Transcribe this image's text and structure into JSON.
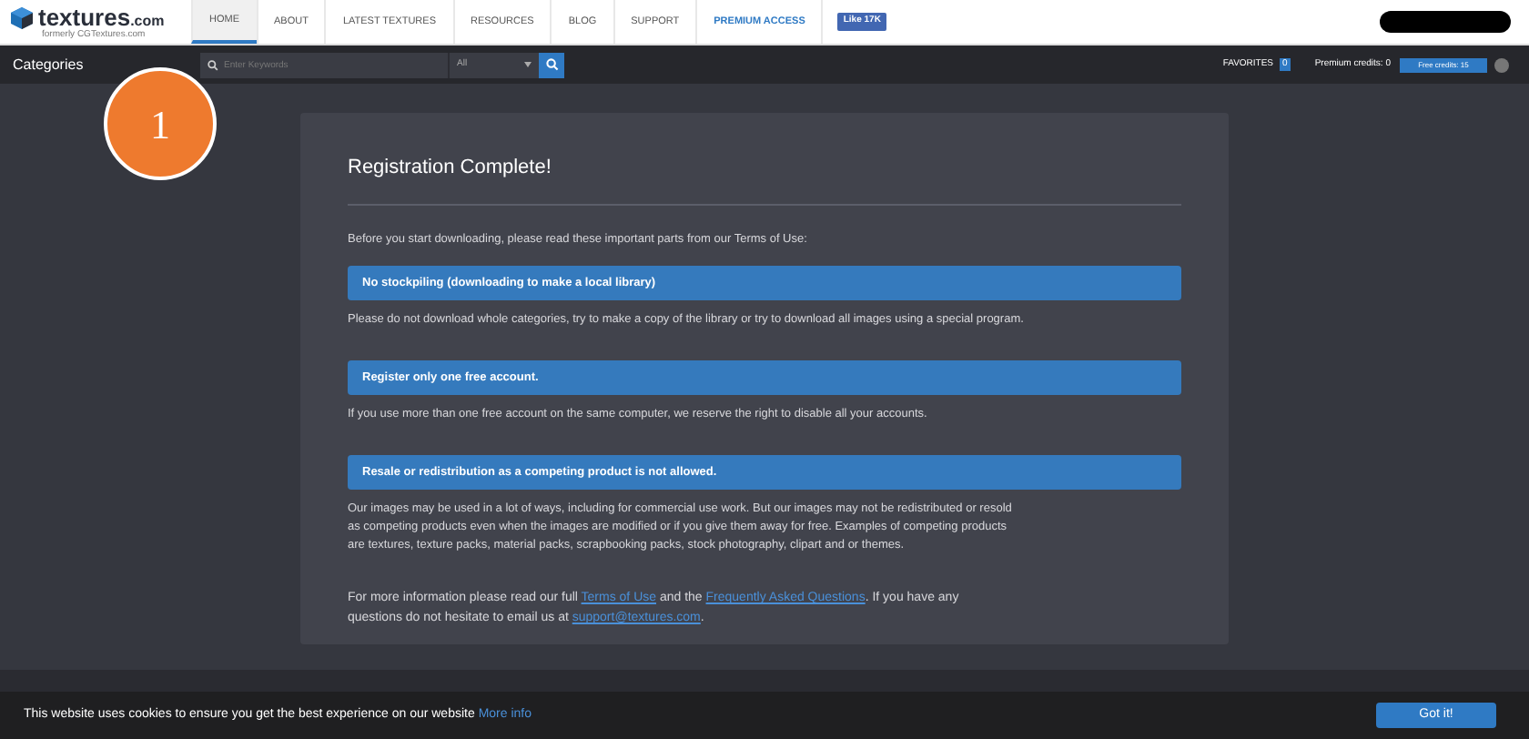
{
  "logo": {
    "name": "textures",
    "suffix": ".com",
    "tagline": "formerly CGTextures.com"
  },
  "nav": [
    {
      "label": "HOME",
      "selected": true,
      "kind": "link"
    },
    {
      "label": "ABOUT",
      "selected": false,
      "kind": "link"
    },
    {
      "label": "LATEST TEXTURES",
      "selected": false,
      "kind": "link"
    },
    {
      "label": "RESOURCES",
      "selected": false,
      "kind": "link"
    },
    {
      "label": "BLOG",
      "selected": false,
      "kind": "link"
    },
    {
      "label": "SUPPORT",
      "selected": false,
      "kind": "link"
    },
    {
      "label": "PREMIUM ACCESS",
      "selected": false,
      "kind": "premium"
    }
  ],
  "like_button": "Like 17K",
  "toolbar": {
    "categories": "Categories",
    "search": {
      "placeholder": "Enter Keywords"
    },
    "filter": "All",
    "favorites": "FAVORITES",
    "favorites_count": "0",
    "premium_credits": "Premium credits: 0",
    "free_credits": "Free credits: 15"
  },
  "callout": "1",
  "card": {
    "title": "Registration Complete!",
    "intro": "Before you start downloading, please read these important parts from our Terms of Use:",
    "rules": [
      {
        "heading": "No stockpiling (downloading to make a local library)",
        "text": "Please do not download whole categories, try to make a copy of the library or try to download all images using a special program."
      },
      {
        "heading": "Register only one free account.",
        "text": "If you use more than one free account on the same computer, we reserve the right to disable all your accounts."
      },
      {
        "heading": "Resale or redistribution as a competing product is not allowed.",
        "text": "Our images may be used in a lot of ways, including for commercial use work. But our images may not be redistributed or resold as competing products even when the images are modified or if you give them away for free. Examples of competing products are textures, texture packs, material packs, scrapbooking packs, stock photography, clipart and or themes."
      }
    ],
    "footer": [
      {
        "kind": "text",
        "text": "For more information please read our full "
      },
      {
        "kind": "link",
        "text": "Terms of Use"
      },
      {
        "kind": "text",
        "text": " and the "
      },
      {
        "kind": "link",
        "text": "Frequently Asked Questions"
      },
      {
        "kind": "text",
        "text": ". If you have any questions do not hesitate to email us at "
      },
      {
        "kind": "link",
        "text": "support@textures.com"
      },
      {
        "kind": "text",
        "text": "."
      }
    ]
  },
  "cookie_bar": {
    "text": "This website uses cookies to ensure you get the best experience on our website",
    "link": "More info",
    "button": "Got it!"
  }
}
